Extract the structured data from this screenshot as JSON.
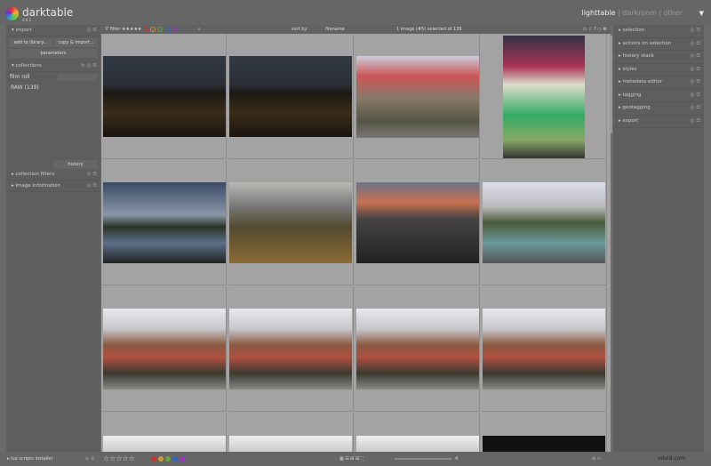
{
  "app": {
    "name": "darktable",
    "version": "4.6.1"
  },
  "views": {
    "lighttable": "lighttable",
    "sep1": "|",
    "darkroom": "darkroom",
    "sep2": "|",
    "other": "other"
  },
  "left": {
    "import": {
      "title": "import",
      "add": "add to library...",
      "copy": "copy & import...",
      "params": "parameters"
    },
    "collections": {
      "title": "collections",
      "field": "film roll",
      "item": "RAW (139)",
      "history": "history"
    },
    "modules": [
      "collection filters",
      "image information"
    ],
    "lua": "lua scripts installer"
  },
  "toolbar": {
    "filter": "filter",
    "stars": "★★★★★",
    "sortby": "sort by",
    "sort_value": "filename",
    "status": "1 image (#5) selected of 139"
  },
  "right": {
    "modules": [
      "selection",
      "actions on selection",
      "history stack",
      "styles",
      "metadata editor",
      "tagging",
      "geotagging",
      "export"
    ]
  },
  "bottom": {
    "stars": "☆☆☆☆☆",
    "zoom": "4",
    "watermark": "vdvid.com"
  },
  "colors": {
    "labels": [
      "#c33",
      "#c93",
      "#6a3",
      "#36c",
      "#93c"
    ]
  },
  "thumbs": [
    {
      "kind": "night"
    },
    {
      "kind": "night"
    },
    {
      "kind": "market"
    },
    {
      "kind": "market-portrait"
    },
    {
      "kind": "lake"
    },
    {
      "kind": "hill"
    },
    {
      "kind": "mountain"
    },
    {
      "kind": "pool"
    },
    {
      "kind": "village"
    },
    {
      "kind": "village"
    },
    {
      "kind": "village"
    },
    {
      "kind": "village"
    },
    {
      "kind": "bw"
    },
    {
      "kind": "bw"
    },
    {
      "kind": "bw"
    },
    {
      "kind": "dark"
    }
  ]
}
